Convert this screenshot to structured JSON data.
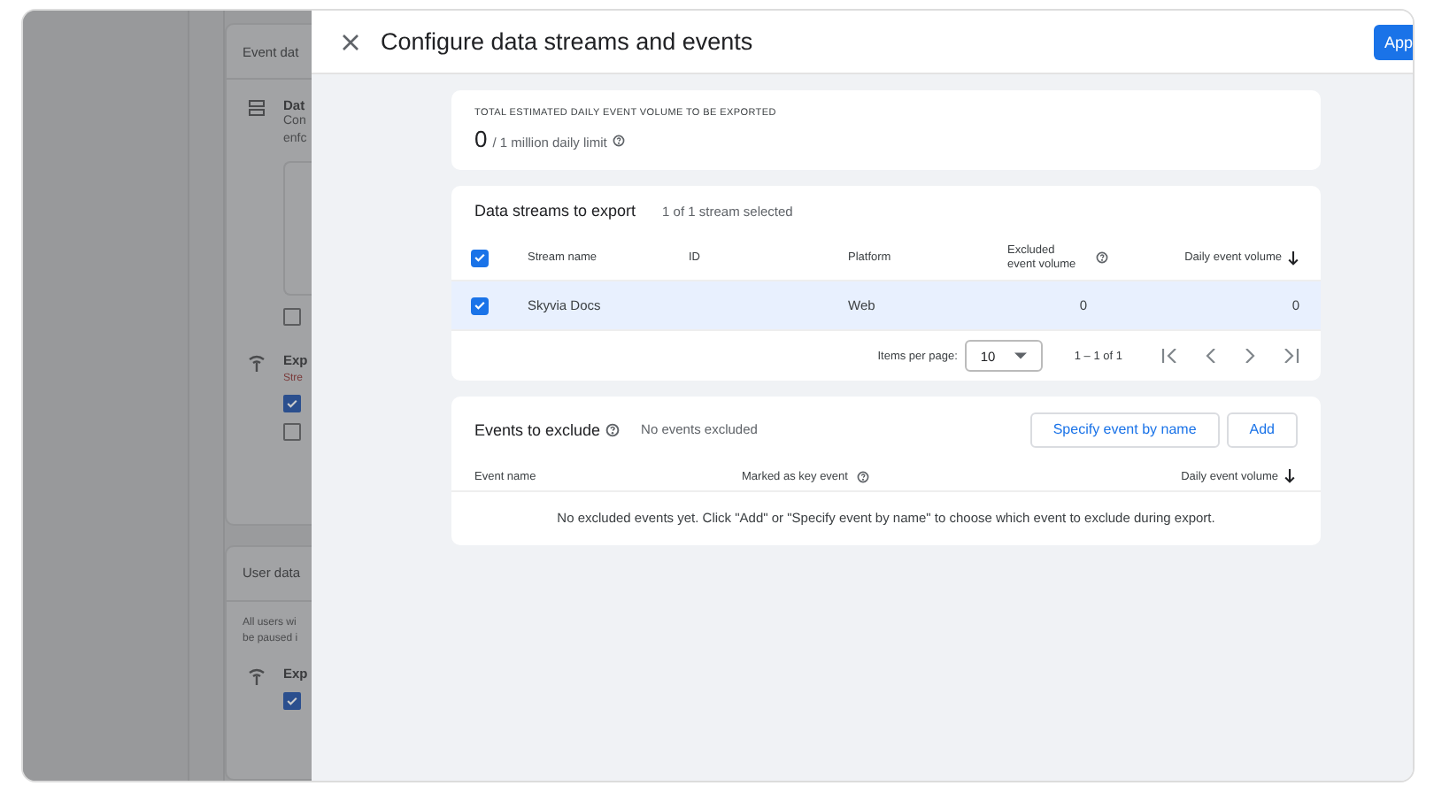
{
  "background_page": {
    "event_section": {
      "title": "Event dat",
      "data_item": {
        "title": "Dat",
        "lines": [
          "Con",
          "enfc"
        ]
      },
      "option_checkbox": {
        "checked": false
      },
      "export_item": {
        "title": "Exp",
        "warning": "Stre",
        "checkboxes": [
          {
            "checked": true
          },
          {
            "checked": false
          }
        ]
      }
    },
    "user_section": {
      "title": "User data",
      "lines": [
        "All users wi",
        "be paused i"
      ],
      "export_item": {
        "title": "Exp",
        "checkboxes": [
          {
            "checked": true
          }
        ]
      }
    }
  },
  "panel": {
    "title": "Configure data streams and events",
    "apply_button": "App"
  },
  "volume_card": {
    "label": "TOTAL ESTIMATED DAILY EVENT VOLUME TO BE EXPORTED",
    "value": "0",
    "limit": "/ 1 million daily limit",
    "help": true
  },
  "streams_card": {
    "title": "Data streams to export",
    "status": "1 of 1 stream selected",
    "select_all": {
      "checked": true
    },
    "columns": [
      {
        "label": "Stream name"
      },
      {
        "label": "ID"
      },
      {
        "label": "Platform"
      },
      {
        "label": "Excluded event volume",
        "help": true
      },
      {
        "label": "Daily event volume",
        "sorted_descending": true
      }
    ],
    "rows": [
      {
        "checked": true,
        "stream_name": "Skyvia Docs",
        "platform": "Web",
        "excluded": "0",
        "daily": "0"
      }
    ],
    "pagination": {
      "label": "Items per page:",
      "per_page": "10",
      "range": "1 – 1 of 1"
    }
  },
  "events_card": {
    "title": "Events to exclude",
    "help": true,
    "status": "No events excluded",
    "buttons": [
      "Specify event by name",
      "Add"
    ],
    "columns": [
      {
        "label": "Event name"
      },
      {
        "label": "Marked as key event",
        "help": true
      },
      {
        "label": "Daily event volume",
        "sorted_descending": true
      }
    ],
    "empty_message": "No excluded events yet. Click \"Add\" or \"Specify event by name\" to choose which event to exclude during export."
  }
}
